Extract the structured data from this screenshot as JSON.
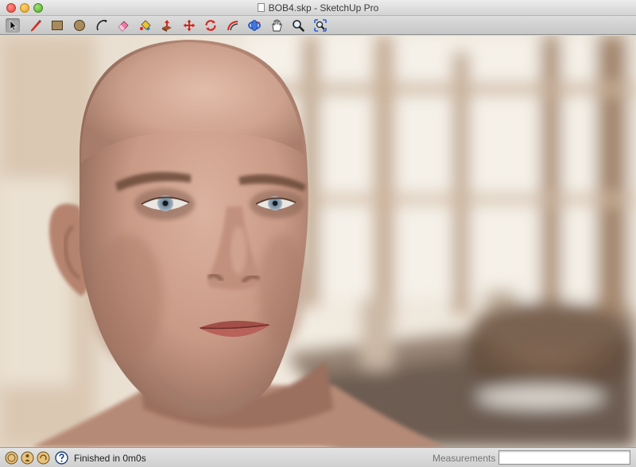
{
  "window": {
    "title": "BOB4.skp - SketchUp Pro"
  },
  "toolbar": {
    "tools": [
      {
        "name": "select",
        "icon": "arrow-cursor-icon",
        "selected": true
      },
      {
        "name": "line",
        "icon": "pencil-icon"
      },
      {
        "name": "rectangle",
        "icon": "rectangle-icon"
      },
      {
        "name": "circle",
        "icon": "circle-icon"
      },
      {
        "name": "arc",
        "icon": "arc-icon"
      },
      {
        "name": "eraser",
        "icon": "eraser-icon"
      },
      {
        "name": "paint-bucket",
        "icon": "paint-bucket-icon"
      },
      {
        "name": "push-pull",
        "icon": "push-pull-icon"
      },
      {
        "name": "move",
        "icon": "move-arrows-icon"
      },
      {
        "name": "rotate",
        "icon": "rotate-icon"
      },
      {
        "name": "offset",
        "icon": "offset-icon"
      },
      {
        "name": "orbit",
        "icon": "orbit-icon"
      },
      {
        "name": "pan",
        "icon": "hand-icon"
      },
      {
        "name": "zoom",
        "icon": "magnifier-icon"
      },
      {
        "name": "zoom-extents",
        "icon": "zoom-extents-icon"
      }
    ]
  },
  "viewport": {
    "scene": "rendered-face-icon"
  },
  "statusbar": {
    "icons": [
      "geo-location-icon",
      "credits-icon",
      "user-icon",
      "help-icon"
    ],
    "message": "Finished in 0m0s",
    "measurements_label": "Measurements",
    "measurements_value": ""
  },
  "colors": {
    "toolbar_bg": "#d4d4d4",
    "status_bg": "#dadada",
    "skin": "#c99a86"
  }
}
